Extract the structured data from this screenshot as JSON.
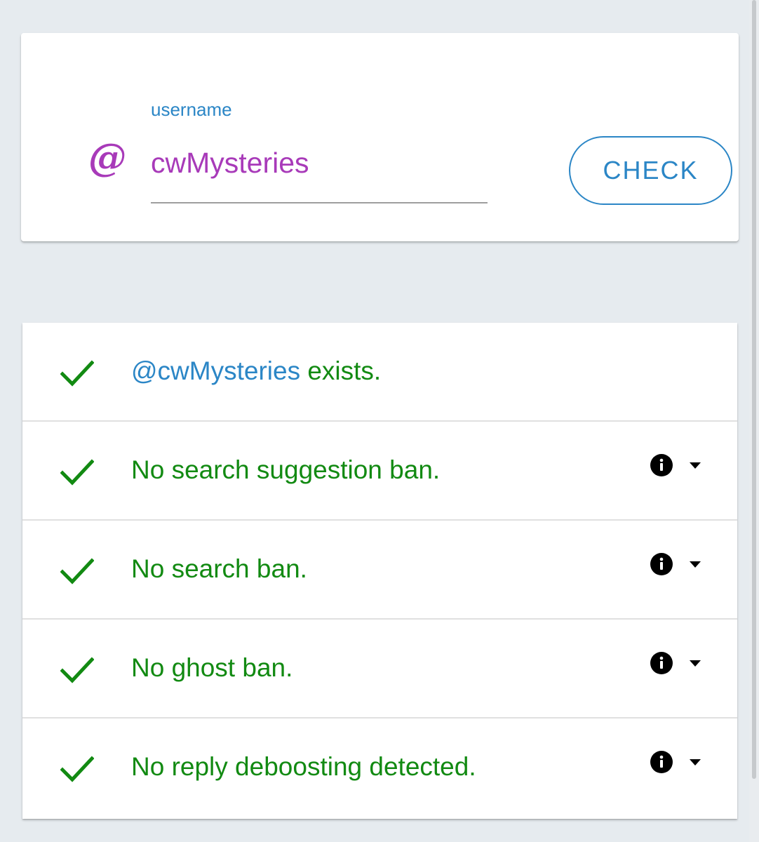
{
  "colors": {
    "primary": "#2b86c6",
    "accent": "#a83ab9",
    "success": "#128a12",
    "icon_dark": "#000000"
  },
  "search": {
    "at_symbol": "@",
    "label": "username",
    "value": "cwMysteries",
    "button_label": "CHECK"
  },
  "results": [
    {
      "handle": "@cwMysteries",
      "text": " exists.",
      "icon": "check-icon",
      "has_info": false
    },
    {
      "text": "No search suggestion ban.",
      "icon": "check-icon",
      "has_info": true
    },
    {
      "text": "No search ban.",
      "icon": "check-icon",
      "has_info": true
    },
    {
      "text": "No ghost ban.",
      "icon": "check-icon",
      "has_info": true
    },
    {
      "text": "No reply deboosting detected.",
      "icon": "check-icon",
      "has_info": true
    }
  ]
}
